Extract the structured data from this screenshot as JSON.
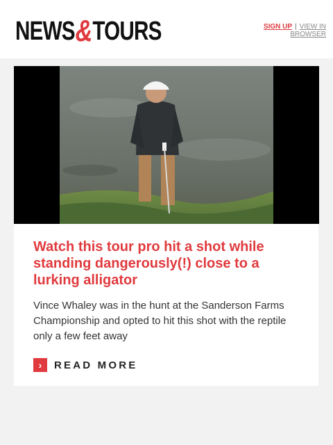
{
  "header": {
    "logo": {
      "part1": "NEWS",
      "amp": "&",
      "part2": "TOURS"
    },
    "links": {
      "signup": "SIGN UP",
      "separator": "|",
      "view_browser": "VIEW IN BROWSER"
    }
  },
  "article": {
    "title": "Watch this tour pro hit a shot while standing dangerously(!) close to a lurking alligator",
    "description": "Vince Whaley was in the hunt at the Sanderson Farms Championship and opted to hit this shot with the reptile only a few feet away",
    "read_more": "READ MORE",
    "read_more_icon": "chevron-right-icon"
  },
  "colors": {
    "accent": "#e03a3e",
    "text": "#333333",
    "background": "#f2f2f2"
  }
}
